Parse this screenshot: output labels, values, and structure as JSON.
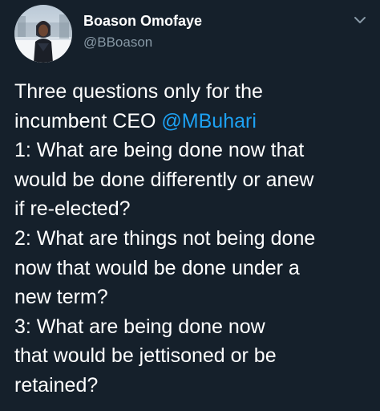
{
  "author": {
    "display_name": "Boason Omofaye",
    "handle": "@BBoason",
    "avatar_icon": "avatar-photo",
    "caret_icon": "chevron-down-icon"
  },
  "tweet": {
    "lines": [
      "Three questions only for the",
      "incumbent CEO ",
      "1: What are being done now that",
      "would be done differently or anew",
      "if re-elected?",
      "2: What are things not being done",
      "now that would be done under a",
      "new term?",
      "3: What are being done now",
      "that would be jettisoned or be",
      "retained?"
    ],
    "mention": "@MBuhari"
  },
  "colors": {
    "background": "#15202b",
    "text": "#ffffff",
    "secondary": "#8899a6",
    "link": "#1da1f2"
  }
}
